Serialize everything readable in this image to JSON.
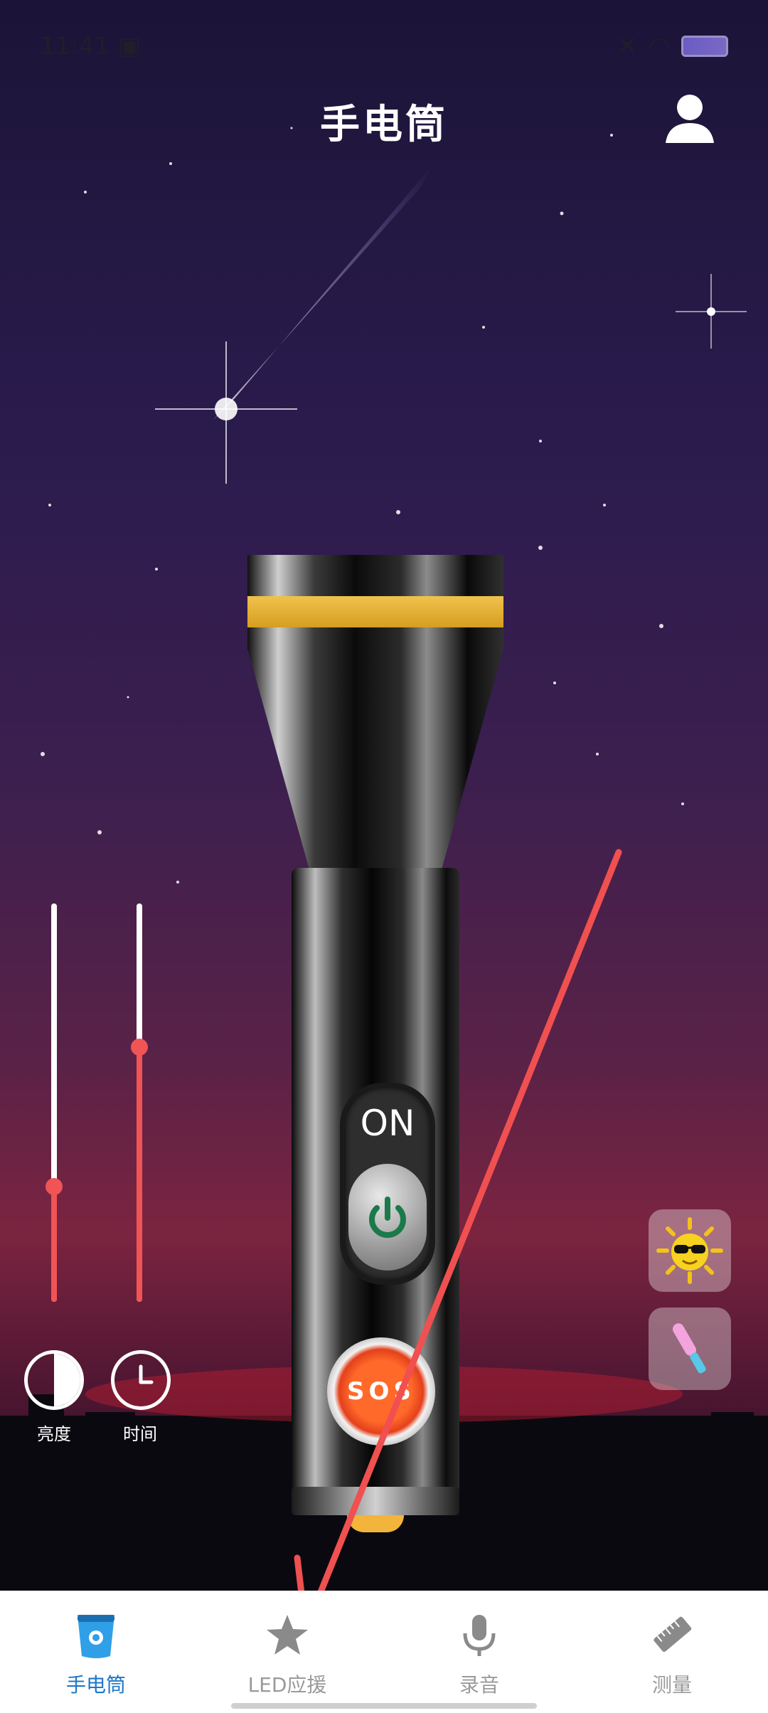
{
  "status_bar": {
    "time": "11:41"
  },
  "header": {
    "title": "手电筒"
  },
  "flashlight": {
    "switch_label": "ON",
    "sos_label": "SOS"
  },
  "sliders": {
    "brightness_level": 0.29,
    "time_level": 0.64
  },
  "controls": {
    "brightness_label": "亮度",
    "time_label": "时间"
  },
  "side_buttons": [
    "sun-emoji-icon",
    "glow-stick-icon"
  ],
  "bottom_nav": [
    {
      "label": "手电筒",
      "icon": "flashlight-icon",
      "active": true
    },
    {
      "label": "LED应援",
      "icon": "star-icon",
      "active": false
    },
    {
      "label": "录音",
      "icon": "microphone-icon",
      "active": false
    },
    {
      "label": "测量",
      "icon": "ruler-icon",
      "active": false
    }
  ],
  "colors": {
    "accent_red": "#f05454",
    "active_blue": "#1f78c8",
    "power_green": "#1a7a4a"
  }
}
